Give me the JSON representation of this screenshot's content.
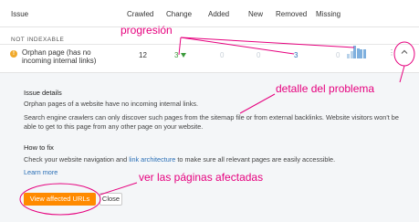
{
  "table": {
    "columns": [
      "Issue",
      "Crawled",
      "Change",
      "Added",
      "New",
      "Removed",
      "Missing"
    ],
    "section_label": "NOT INDEXABLE",
    "row": {
      "warning_glyph": "!",
      "title": "Orphan page (has no incoming internal links)",
      "crawled": "12",
      "change": "3",
      "added": "0",
      "new": "0",
      "removed": "3",
      "missing": "0",
      "more_glyph": "⋮",
      "sparkline": [
        0.35,
        0.55,
        1.0,
        0.8,
        0.75,
        0.7
      ]
    }
  },
  "details": {
    "issue_title": "Issue details",
    "issue_text": "Orphan pages of a website have no incoming internal links.",
    "issue_text2": "Search engine crawlers can only discover such pages from the sitemap file or from external backlinks. Website visitors won't be able to get to this page from any other page on your website.",
    "fix_title": "How to fix",
    "fix_prefix": "Check your website navigation and ",
    "fix_link": "link architecture",
    "fix_suffix": " to make sure all relevant pages are easily accessible.",
    "learn_more": "Learn more",
    "view_button": "View affected URLs",
    "close_button": "Close"
  },
  "annotations": {
    "progresion": "progresión",
    "detalle": "detalle del problema",
    "ver": "ver las páginas afectadas",
    "color": "#e6007e"
  },
  "colors": {
    "accent_button": "#ff8a00",
    "link": "#2a6fb6",
    "positive": "#3a9a3a",
    "warning": "#f0a92b"
  }
}
